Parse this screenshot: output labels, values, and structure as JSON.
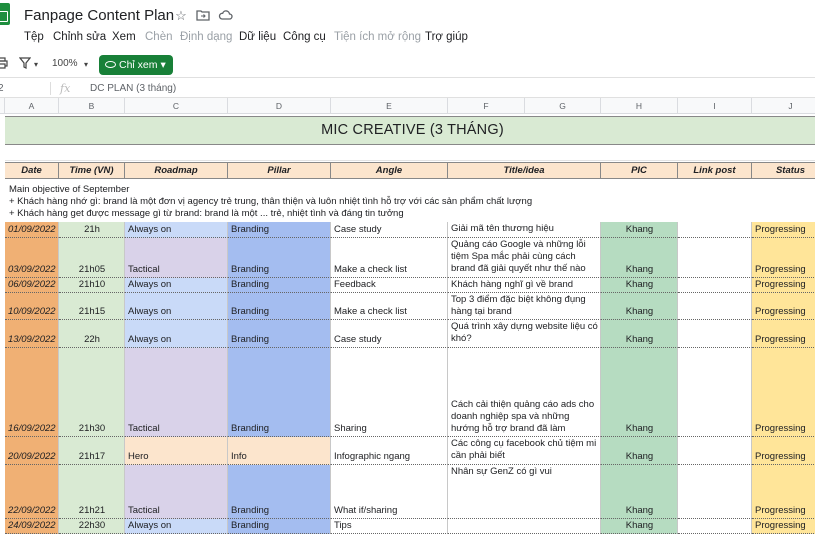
{
  "doc_title": "Fanpage Content Plan",
  "title_icons": [
    "star-icon",
    "move-to-folder-icon",
    "cloud-status-icon"
  ],
  "menu": [
    "Tệp",
    "Chỉnh sửa",
    "Xem",
    "Chèn",
    "Định dạng",
    "Dữ liệu",
    "Công cụ",
    "Tiện ích mở rộng",
    "Trợ giúp"
  ],
  "toolbar": {
    "zoom": "100%",
    "view_mode": "Chỉ xem"
  },
  "formula_bar": {
    "cell_ref": "2",
    "value": "DC PLAN (3 tháng)"
  },
  "columns": [
    "A",
    "B",
    "C",
    "D",
    "E",
    "F",
    "G",
    "H",
    "I",
    "J"
  ],
  "banner": "MIC CREATIVE (3 THÁNG)",
  "headers": [
    "Date",
    "Time (VN)",
    "Roadmap",
    "Pillar",
    "Angle",
    "Title/idea",
    "PIC",
    "Link post",
    "Status"
  ],
  "objective": [
    "Main objective of September",
    "+ Khách hàng nhớ gì: brand là một đơn vị agency trẻ trung, thân thiện và luôn nhiệt tình hỗ trợ với các sản phẩm chất lượng",
    "+ Khách hàng get được message gì từ brand: brand là một ... trẻ, nhiệt tình và đáng tin tưởng"
  ],
  "rows": [
    {
      "date": "01/09/2022",
      "time": "21h",
      "roadmap": "Always on",
      "pillar": "Branding",
      "angle": "Case study",
      "title": "Giải mã tên thương hiệu",
      "pic": "Khang",
      "link": "",
      "status": "Progressing"
    },
    {
      "date": "03/09/2022",
      "time": "21h05",
      "roadmap": "Tactical",
      "pillar": "Branding",
      "angle": "Make a check list",
      "title": "Quảng cáo Google và những lỗi tiệm Spa mắc phải cùng cách brand đã giải quyết như thế nào",
      "pic": "Khang",
      "link": "",
      "status": "Progressing"
    },
    {
      "date": "06/09/2022",
      "time": "21h10",
      "roadmap": "Always on",
      "pillar": "Branding",
      "angle": "Feedback",
      "title": "Khách hàng nghĩ gì về brand",
      "pic": "Khang",
      "link": "",
      "status": "Progressing"
    },
    {
      "date": "10/09/2022",
      "time": "21h15",
      "roadmap": "Always on",
      "pillar": "Branding",
      "angle": "Make a check list",
      "title": "Top 3 điểm đặc biệt không đụng hàng tại brand",
      "pic": "Khang",
      "link": "",
      "status": "Progressing"
    },
    {
      "date": "13/09/2022",
      "time": "22h",
      "roadmap": "Always on",
      "pillar": "Branding",
      "angle": "Case  study",
      "title": "Quá trình xây dựng website liệu có khó?",
      "pic": "Khang",
      "link": "",
      "status": "Progressing"
    },
    {
      "date": "16/09/2022",
      "time": "21h30",
      "roadmap": "Tactical",
      "pillar": "Branding",
      "angle": "Sharing",
      "title": "Cách cải thiện quảng cáo ads cho doanh nghiệp spa và những hướng hỗ trợ brand đã làm",
      "pic": "Khang",
      "link": "",
      "status": "Progressing"
    },
    {
      "date": "20/09/2022",
      "time": "21h17",
      "roadmap": "Hero",
      "pillar": "Info",
      "angle": "Infographic ngang",
      "title": "Các công cụ facebook chủ tiệm mi cần phải biết",
      "pic": "Khang",
      "link": "",
      "status": "Progressing"
    },
    {
      "date": "22/09/2022",
      "time": "21h21",
      "roadmap": "Tactical",
      "pillar": "Branding",
      "angle": "What if/sharing",
      "title": "Nhân sự GenZ có gì vui",
      "pic": "Khang",
      "link": "",
      "status": "Progressing"
    },
    {
      "date": "24/09/2022",
      "time": "22h30",
      "roadmap": "Always on",
      "pillar": "Branding",
      "angle": "Tips",
      "title": "",
      "pic": "Khang",
      "link": "",
      "status": "Progressing"
    }
  ],
  "colors": {
    "date_col": "#f0b074",
    "time_col": "#d9ead3",
    "roadmap_always": "#c9daf8",
    "roadmap_tactical": "#d9d2e9",
    "roadmap_hero": "#fce5cd",
    "pillar_branding": "#a4bdf0",
    "pillar_info": "#fce5cd",
    "pic_col": "#b6dcc1",
    "status_col": "#ffe599",
    "header_bg": "#fce5cd",
    "banner_bg": "#d9ead3"
  }
}
